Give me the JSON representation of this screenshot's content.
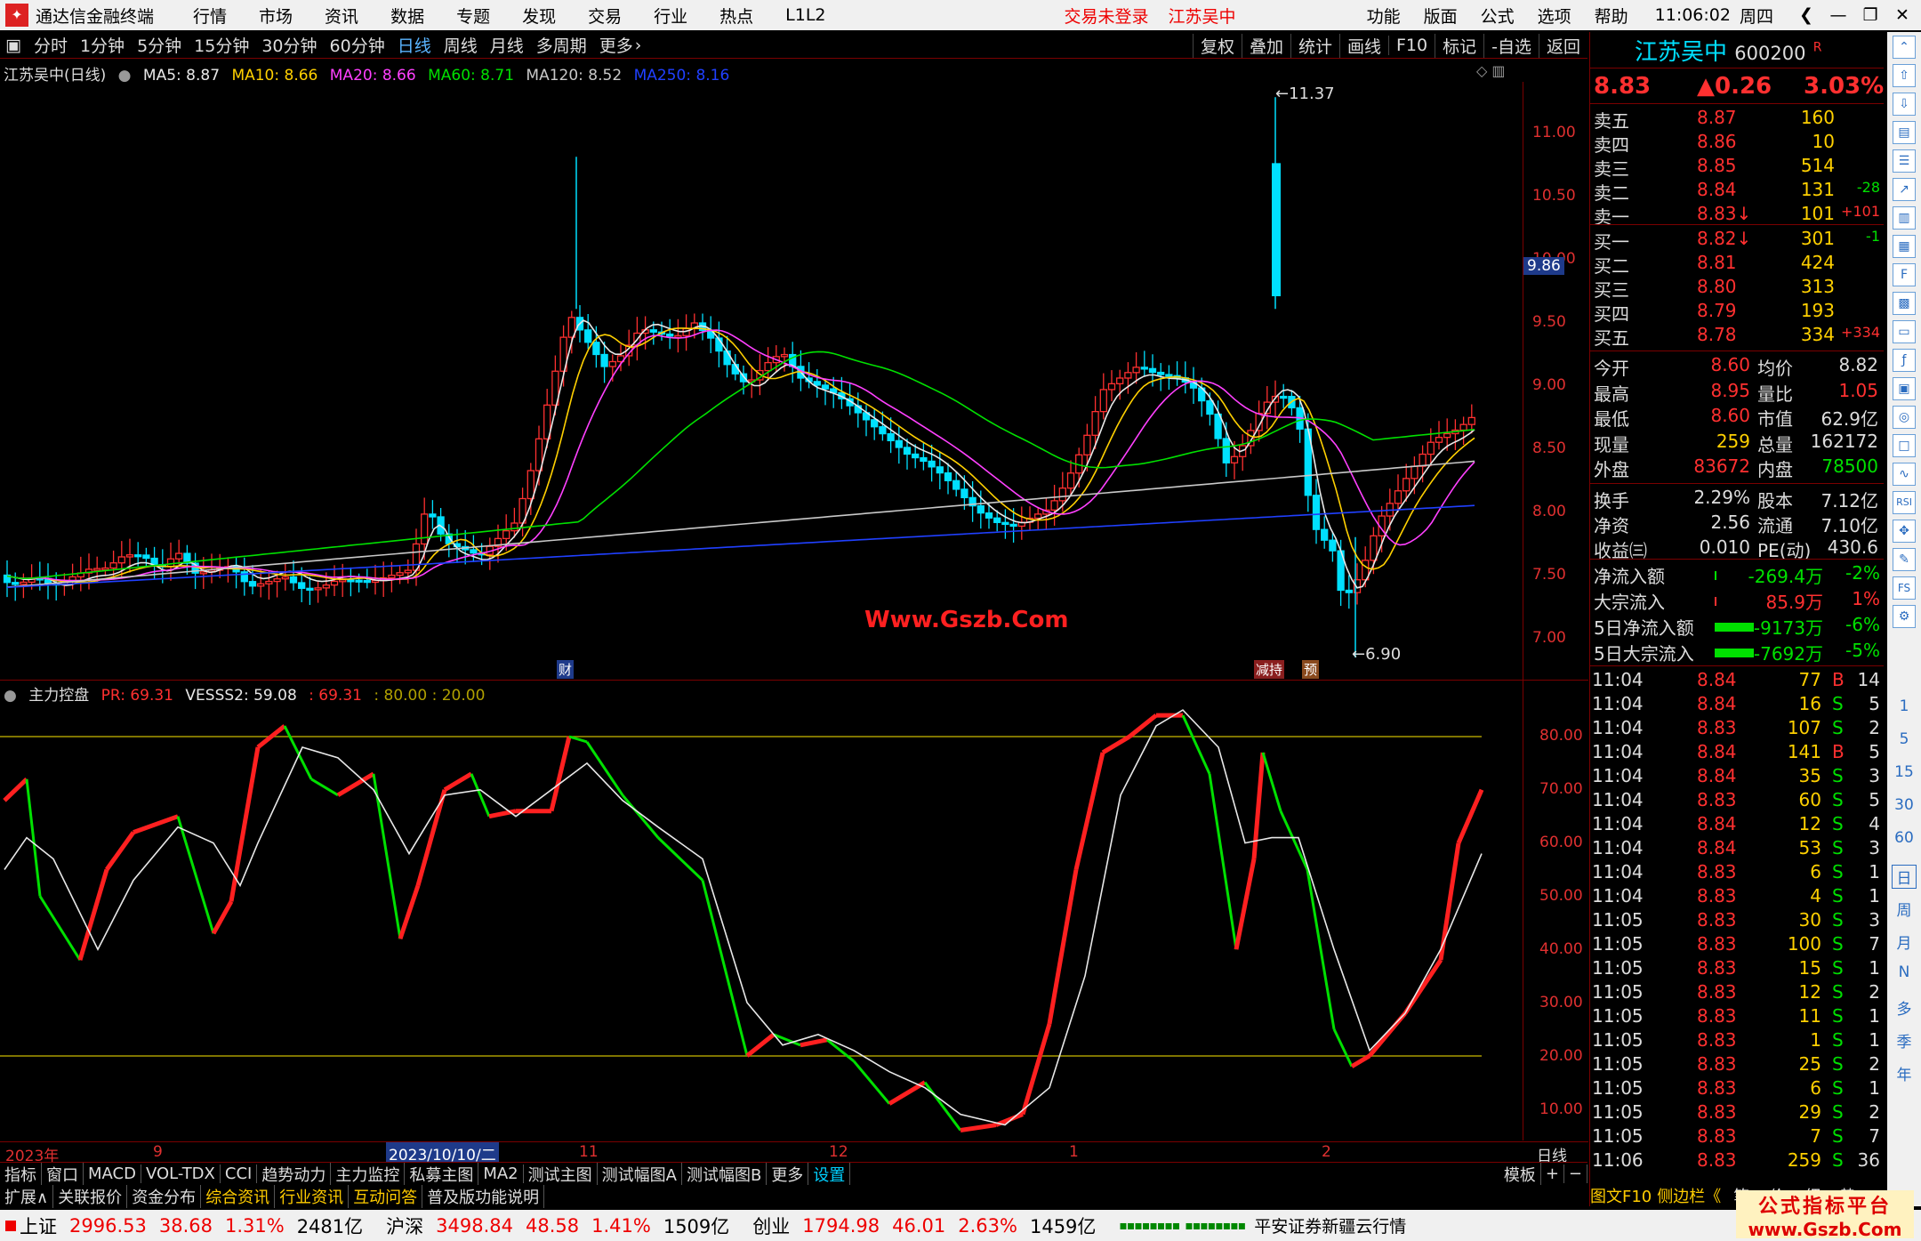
{
  "titlebar": {
    "app_title": "通达信金融终端",
    "menu": [
      "行情",
      "市场",
      "资讯",
      "数据",
      "专题",
      "发现",
      "交易",
      "行业",
      "热点",
      "L1L2"
    ],
    "trade_status": "交易未登录",
    "stock_name": "江苏吴中",
    "right_menu": [
      "功能",
      "版面",
      "公式",
      "选项",
      "帮助"
    ],
    "time": "11:06:02",
    "weekday": "周四"
  },
  "periods": [
    "分时",
    "1分钟",
    "5分钟",
    "15分钟",
    "30分钟",
    "60分钟",
    "日线",
    "周线",
    "月线",
    "多周期",
    "更多"
  ],
  "active_period": "日线",
  "chart_tools": [
    "复权",
    "叠加",
    "统计",
    "画线",
    "F10",
    "标记",
    "-自选",
    "返回"
  ],
  "main_chart": {
    "title": "江苏吴中(日线)",
    "ma": [
      {
        "label": "MA5: 8.87",
        "color": "#e8e8e8"
      },
      {
        "label": "MA10: 8.66",
        "color": "#ffd000"
      },
      {
        "label": "MA20: 8.66",
        "color": "#ff40ff"
      },
      {
        "label": "MA60: 8.71",
        "color": "#00e000"
      },
      {
        "label": "MA120: 8.52",
        "color": "#c8c8c8"
      },
      {
        "label": "MA250: 8.16",
        "color": "#2040ff"
      }
    ],
    "price_ticks": [
      "11.00",
      "10.50",
      "10.00",
      "9.50",
      "9.00",
      "8.50",
      "8.00",
      "7.50",
      "7.00"
    ],
    "current_price_tag": "9.86",
    "high_label": "11.37",
    "low_label": "6.90",
    "watermark": "Www.Gszb.Com",
    "markers": [
      "财",
      "减持",
      "预"
    ]
  },
  "sub_chart": {
    "title": "主力控盘",
    "legend": [
      {
        "label": "PR: 69.31",
        "color": "#ff3030"
      },
      {
        "label": "VESSS2: 59.08",
        "color": "#e8e8e8"
      },
      {
        "label": ": 69.31",
        "color": "#ff3030"
      },
      {
        "label": ": 80.00 : 20.00",
        "color": "#b0a000"
      }
    ],
    "ticks": [
      "80.00",
      "70.00",
      "60.00",
      "50.00",
      "40.00",
      "30.00",
      "20.00",
      "10.00"
    ]
  },
  "time_axis": {
    "labels": [
      "2023年",
      "9",
      "2023/10/10/二",
      "11",
      "12",
      "1",
      "2"
    ],
    "period_label": "日线"
  },
  "indicator_tabs": [
    "指标",
    "窗口",
    "MACD",
    "VOL-TDX",
    "CCI",
    "趋势动力",
    "主力监控",
    "私募主图",
    "MA2",
    "测试主图",
    "测试幅图A",
    "测试幅图B",
    "更多",
    "设置"
  ],
  "indicator_tabs_right": [
    "模板",
    "+",
    "−"
  ],
  "info_tabs": [
    "扩展∧",
    "关联报价",
    "资金分布",
    "综合资讯",
    "行业资讯",
    "互动问答",
    "普及版功能说明"
  ],
  "quote": {
    "name": "江苏吴中",
    "code": "600200",
    "flag": "R",
    "price": "8.83",
    "change": "▲0.26",
    "pct": "3.03%",
    "asks": [
      {
        "label": "卖五",
        "price": "8.87",
        "vol": "160",
        "delta": ""
      },
      {
        "label": "卖四",
        "price": "8.86",
        "vol": "10",
        "delta": ""
      },
      {
        "label": "卖三",
        "price": "8.85",
        "vol": "514",
        "delta": ""
      },
      {
        "label": "卖二",
        "price": "8.84",
        "vol": "131",
        "delta": "-28"
      },
      {
        "label": "卖一",
        "price": "8.83↓",
        "vol": "101",
        "delta": "+101"
      }
    ],
    "bids": [
      {
        "label": "买一",
        "price": "8.82↓",
        "vol": "301",
        "delta": "-1"
      },
      {
        "label": "买二",
        "price": "8.81",
        "vol": "424",
        "delta": ""
      },
      {
        "label": "买三",
        "price": "8.80",
        "vol": "313",
        "delta": ""
      },
      {
        "label": "买四",
        "price": "8.79",
        "vol": "193",
        "delta": ""
      },
      {
        "label": "买五",
        "price": "8.78",
        "vol": "334",
        "delta": "+334"
      }
    ],
    "stats": [
      {
        "l1": "今开",
        "v1": "8.60",
        "l2": "均价",
        "v2": "8.82"
      },
      {
        "l1": "最高",
        "v1": "8.95",
        "l2": "量比",
        "v2": "1.05"
      },
      {
        "l1": "最低",
        "v1": "8.60",
        "l2": "市值",
        "v2": "62.9亿"
      },
      {
        "l1": "现量",
        "v1": "259",
        "l2": "总量",
        "v2": "162172"
      },
      {
        "l1": "外盘",
        "v1": "83672",
        "l2": "内盘",
        "v2": "78500"
      }
    ],
    "stats2": [
      {
        "l1": "换手",
        "v1": "2.29%",
        "l2": "股本",
        "v2": "7.12亿"
      },
      {
        "l1": "净资",
        "v1": "2.56",
        "l2": "流通",
        "v2": "7.10亿"
      },
      {
        "l1": "收益㈢",
        "v1": "0.010",
        "l2": "PE(动)",
        "v2": "430.6"
      }
    ],
    "flows": [
      {
        "label": "净流入额",
        "value": "-269.4万",
        "pct": "-2%"
      },
      {
        "label": "大宗流入",
        "value": "85.9万",
        "pct": "1%"
      },
      {
        "label": "5日净流入额",
        "value": "-9173万",
        "pct": "-6%"
      },
      {
        "label": "5日大宗流入",
        "value": "-7692万",
        "pct": "-5%"
      }
    ],
    "ticks": [
      {
        "t": "11:04",
        "p": "8.84",
        "v": "77",
        "s": "B",
        "n": "14"
      },
      {
        "t": "11:04",
        "p": "8.84",
        "v": "16",
        "s": "S",
        "n": "5"
      },
      {
        "t": "11:04",
        "p": "8.83",
        "v": "107",
        "s": "S",
        "n": "2"
      },
      {
        "t": "11:04",
        "p": "8.84",
        "v": "141",
        "s": "B",
        "n": "5"
      },
      {
        "t": "11:04",
        "p": "8.84",
        "v": "35",
        "s": "S",
        "n": "3"
      },
      {
        "t": "11:04",
        "p": "8.83",
        "v": "60",
        "s": "S",
        "n": "5"
      },
      {
        "t": "11:04",
        "p": "8.84",
        "v": "12",
        "s": "S",
        "n": "4"
      },
      {
        "t": "11:04",
        "p": "8.84",
        "v": "53",
        "s": "S",
        "n": "3"
      },
      {
        "t": "11:04",
        "p": "8.83",
        "v": "6",
        "s": "S",
        "n": "1"
      },
      {
        "t": "11:04",
        "p": "8.83",
        "v": "4",
        "s": "S",
        "n": "1"
      },
      {
        "t": "11:05",
        "p": "8.83",
        "v": "30",
        "s": "S",
        "n": "3"
      },
      {
        "t": "11:05",
        "p": "8.83",
        "v": "100",
        "s": "S",
        "n": "7"
      },
      {
        "t": "11:05",
        "p": "8.83",
        "v": "15",
        "s": "S",
        "n": "1"
      },
      {
        "t": "11:05",
        "p": "8.83",
        "v": "12",
        "s": "S",
        "n": "2"
      },
      {
        "t": "11:05",
        "p": "8.83",
        "v": "11",
        "s": "S",
        "n": "1"
      },
      {
        "t": "11:05",
        "p": "8.83",
        "v": "1",
        "s": "S",
        "n": "1"
      },
      {
        "t": "11:05",
        "p": "8.83",
        "v": "25",
        "s": "S",
        "n": "2"
      },
      {
        "t": "11:05",
        "p": "8.83",
        "v": "6",
        "s": "S",
        "n": "1"
      },
      {
        "t": "11:05",
        "p": "8.83",
        "v": "29",
        "s": "S",
        "n": "2"
      },
      {
        "t": "11:05",
        "p": "8.83",
        "v": "7",
        "s": "S",
        "n": "7"
      },
      {
        "t": "11:06",
        "p": "8.83",
        "v": "259",
        "s": "S",
        "n": "36"
      }
    ],
    "bottom_tabs": [
      "图文F10",
      "侧边栏《",
      "笔",
      "价",
      "细",
      "势"
    ]
  },
  "side_strip": [
    "1",
    "5",
    "15",
    "30",
    "60",
    "日",
    "周",
    "月",
    "N",
    "多",
    "季",
    "年"
  ],
  "side_icons": [
    "RSI",
    "FS"
  ],
  "status": {
    "indices": [
      {
        "name": "上证",
        "value": "2996.53",
        "chg": "38.68",
        "pct": "1.31%",
        "amt": "2481亿"
      },
      {
        "name": "沪深",
        "value": "3498.84",
        "chg": "48.58",
        "pct": "1.41%",
        "amt": "1509亿"
      },
      {
        "name": "创业",
        "value": "1794.98",
        "chg": "46.01",
        "pct": "2.63%",
        "amt": "1459亿"
      }
    ],
    "server": "平安证券新疆云行情",
    "stamp_line1": "公式指标平台",
    "stamp_line2": "www.Gszb.Com"
  }
}
